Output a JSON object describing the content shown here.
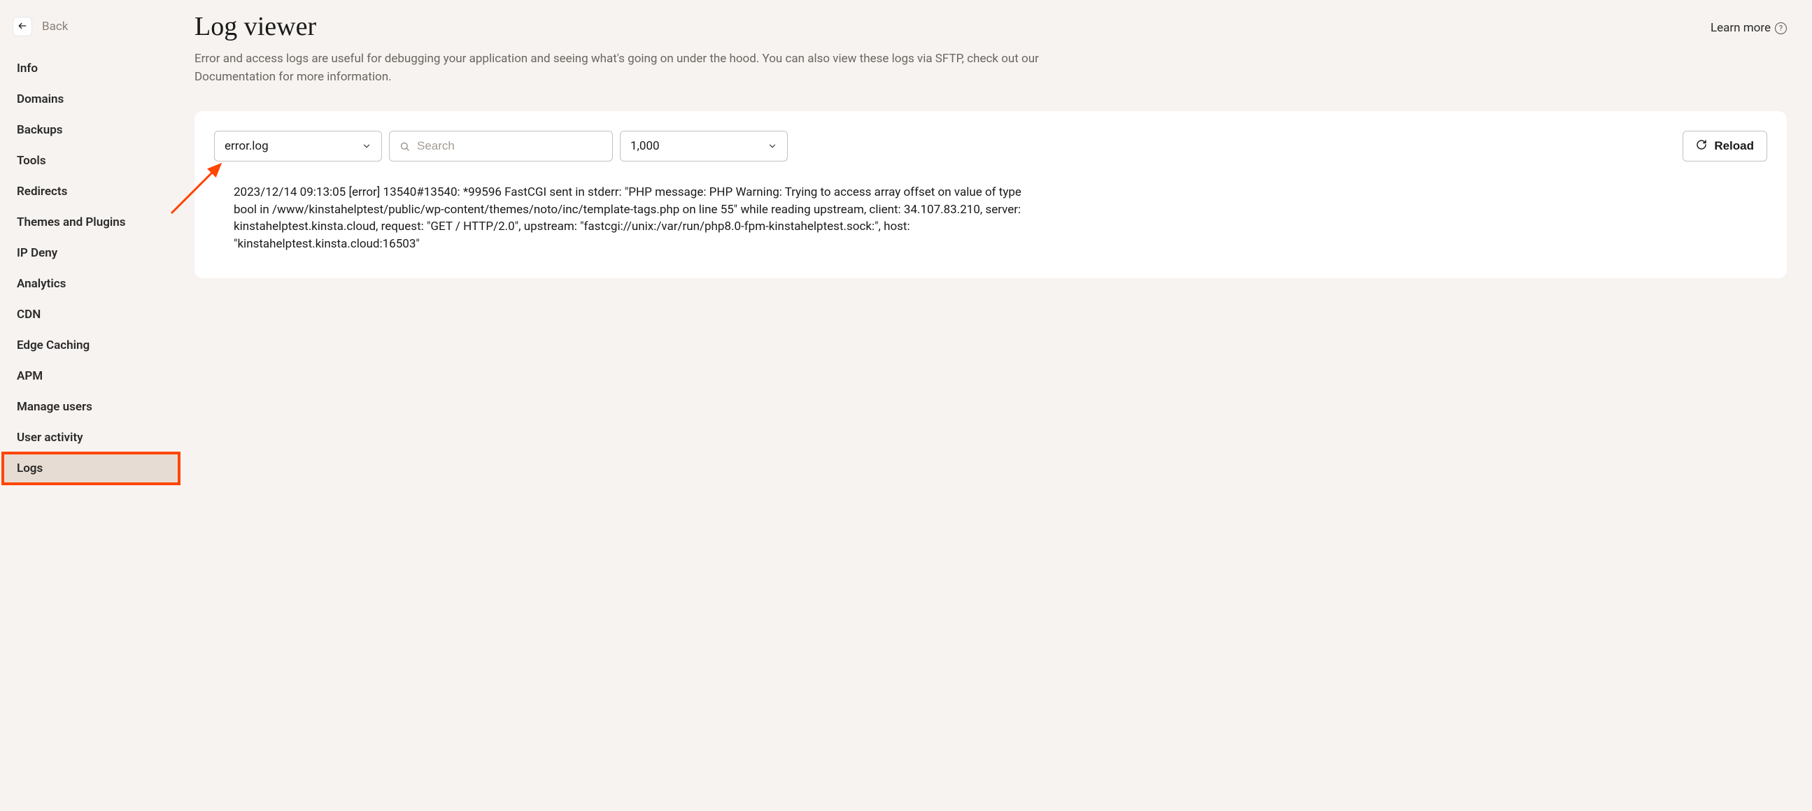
{
  "sidebar": {
    "back_label": "Back",
    "items": [
      {
        "label": "Info"
      },
      {
        "label": "Domains"
      },
      {
        "label": "Backups"
      },
      {
        "label": "Tools"
      },
      {
        "label": "Redirects"
      },
      {
        "label": "Themes and Plugins"
      },
      {
        "label": "IP Deny"
      },
      {
        "label": "Analytics"
      },
      {
        "label": "CDN"
      },
      {
        "label": "Edge Caching"
      },
      {
        "label": "APM"
      },
      {
        "label": "Manage users"
      },
      {
        "label": "User activity"
      },
      {
        "label": "Logs"
      }
    ],
    "active_index": 13
  },
  "header": {
    "title": "Log viewer",
    "learn_more_label": "Learn more",
    "description": "Error and access logs are useful for debugging your application and seeing what's going on under the hood. You can also view these logs via SFTP, check out our Documentation for more information."
  },
  "controls": {
    "log_file_selected": "error.log",
    "search_placeholder": "Search",
    "line_count_selected": "1,000",
    "reload_label": "Reload"
  },
  "logs": {
    "entries": [
      "2023/12/14 09:13:05 [error] 13540#13540: *99596 FastCGI sent in stderr: \"PHP message: PHP Warning: Trying to access array offset on value of type bool in /www/kinstahelptest/public/wp-content/themes/noto/inc/template-tags.php on line 55\" while reading upstream, client: 34.107.83.210, server: kinstahelptest.kinsta.cloud, request: \"GET / HTTP/2.0\", upstream: \"fastcgi://unix:/var/run/php8.0-fpm-kinstahelptest.sock:\", host: \"kinstahelptest.kinsta.cloud:16503\""
    ]
  },
  "annotation": {
    "arrow_color": "#ff4500"
  }
}
